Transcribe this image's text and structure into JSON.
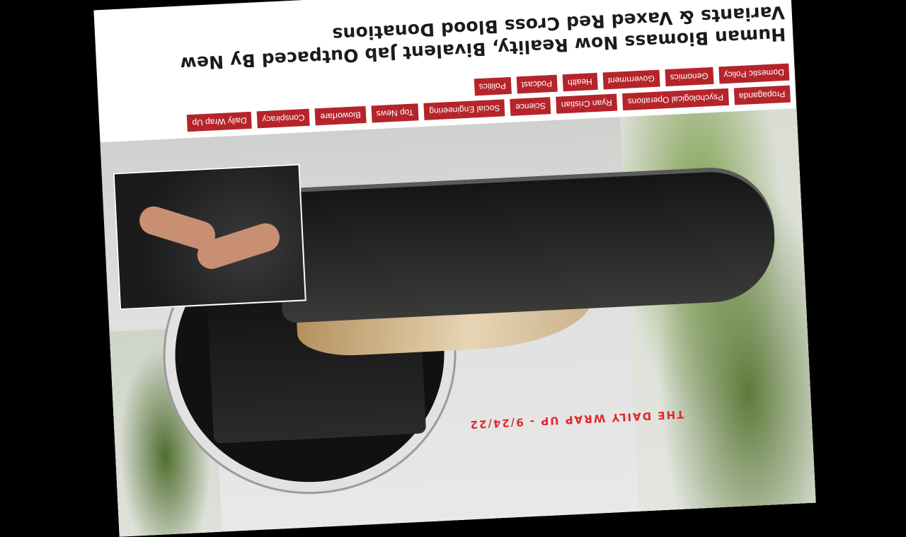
{
  "article": {
    "headline": "Human Biomass Now Reality, Bivalent Jab Outpaced By New Variants & Vaxed Red Cross Blood Donations",
    "tags": [
      "Propaganda",
      "Psychological Operations",
      "Ryan Cristian",
      "Science",
      "Social Engineering",
      "Top News",
      "Bioworfare",
      "Conspiracy",
      "Daily Wrap Up",
      "Domestic Policy",
      "Genomics",
      "Government",
      "Health",
      "Podcast",
      "Politics"
    ]
  },
  "hero_image": {
    "overlay_text": "THE DAILY WRAP UP - 9/24/22",
    "accent_color": "#e2262d",
    "tag_color": "#b5242a"
  }
}
